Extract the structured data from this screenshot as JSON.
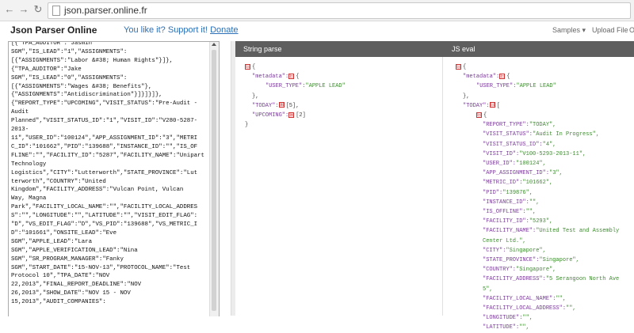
{
  "browser": {
    "url": "json.parser.online.fr"
  },
  "header": {
    "brand": "Json Parser Online",
    "tagline_text": "You like it? Support it!",
    "donate_label": "Donate",
    "menu_samples": "Samples ▾",
    "menu_upload": "Upload File",
    "menu_more": "O"
  },
  "left": {
    "lines": [
      "[{\"TPA_AUDITOR\":\"Jasmin",
      "SGM\",\"IS_LEAD\":\"1\",\"ASSIGNMENTS\":",
      "[{\"ASSIGNMENTS\":\"Labor &#38; Human Rights\"}]},",
      "{\"TPA_AUDITOR\":\"Jake",
      "SGM\",\"IS_LEAD\":\"0\",\"ASSIGNMENTS\":",
      "[{\"ASSIGNMENTS\":\"Wages &#38; Benefits\"},",
      "{\"ASSIGNMENTS\":\"Antidiscrimination\"}]}]}]},",
      "{\"REPORT_TYPE\":\"UPCOMING\",\"VISIT_STATUS\":\"Pre-Audit -",
      "Audit",
      "Planned\",\"VISIT_STATUS_ID\":\"1\",\"VISIT_ID\":\"V280-5287-",
      "2013-",
      "11\",\"USER_ID\":\"100124\",\"APP_ASSIGNMENT_ID\":\"3\",\"METRI",
      "C_ID\":\"101662\",\"PID\":\"139688\",\"INSTANCE_ID\":\"\",\"IS_OF",
      "FLINE\":\"\",\"FACILITY_ID\":\"5287\",\"FACILITY_NAME\":\"Unipart",
      "Technology",
      "Logistics\",\"CITY\":\"Lutterworth\",\"STATE_PROVINCE\":\"Lut",
      "terworth\",\"COUNTRY\":\"United",
      "Kingdom\",\"FACILITY_ADDRESS\":\"Vulcan Point, Vulcan",
      "Way, Magna",
      "Park\",\"FACILITY_LOCAL_NAME\":\"\",\"FACILITY_LOCAL_ADDRES",
      "S\":\"\",\"LONGITUDE\":\"\",\"LATITUDE\":\"\",\"VISIT_EDIT_FLAG\":",
      "\"D\",\"VS_EDIT_FLAG\":\"D\",\"VS_PID\":\"139688\",\"VS_METRIC_I",
      "D\":\"101661\",\"ONSITE_LEAD\":\"Eve",
      "SGM\",\"APPLE_LEAD\":\"Lara",
      "SGM\",\"APPLE_VERIFICATION_LEAD\":\"Nina",
      "SGM\",\"SR_PROGRAM_MANAGER\":\"Fanky",
      "SGM\",\"START_DATE\":\"15-NOV-13\",\"PROTOCOL_NAME\":\"Test",
      "Protocol 10\",\"TPA_DATE\":\"NOV",
      "22,2013\",\"FINAL_REPORT_DEADLINE\":\"NOV",
      "26,2013\",\"SHOW_DATE\":\"NOV 15 - NOV",
      "15,2013\",\"AUDIT_COMPANIES\":"
    ]
  },
  "string_parse": {
    "title": "String parse",
    "toggle_minus": "⊟",
    "toggle_plus": "⊞",
    "open_brace": "{",
    "close_brace": "}",
    "metadata_key": "\"metadata\":",
    "user_type_key": "\"USER_TYPE\":",
    "user_type_value": "\"APPLE LEAD\"",
    "metadata_close": "},",
    "today_key": "\"TODAY\":",
    "today_count": "[5],",
    "upcoming_key": "\"UPCOMING\":",
    "upcoming_count": "[2]"
  },
  "js_eval": {
    "title": "JS eval",
    "open_brace": "{",
    "metadata_key": "\"metadata\":",
    "user_type_key": "\"USER_TYPE\":",
    "user_type_value": "\"APPLE LEAD\"",
    "metadata_close": "},",
    "today_key": "\"TODAY\":",
    "inner_open": "[",
    "item_open": "{",
    "fields": [
      {
        "key": "\"REPORT_TYPE\":",
        "value": "\"TODAY\","
      },
      {
        "key": "\"VISIT_STATUS\":",
        "value": "\"Audit In Progress\","
      },
      {
        "key": "\"VISIT_STATUS_ID\":",
        "value": "\"4\","
      },
      {
        "key": "\"VISIT_ID\":",
        "value": "\"V100-5293-2013-11\","
      },
      {
        "key": "\"USER_ID\":",
        "value": "\"100124\","
      },
      {
        "key": "\"APP_ASSIGNMENT_ID\":",
        "value": "\"3\","
      },
      {
        "key": "\"METRIC_ID\":",
        "value": "\"101662\","
      },
      {
        "key": "\"PID\":",
        "value": "\"139876\","
      },
      {
        "key": "\"INSTANCE_ID\":",
        "value": "\"\","
      },
      {
        "key": "\"IS_OFFLINE\":",
        "value": "\"\","
      },
      {
        "key": "\"FACILITY_ID\":",
        "value": "\"5293\","
      },
      {
        "key": "\"FACILITY_NAME\":",
        "value": "\"United Test and Assembly"
      },
      {
        "key": "",
        "value": "Center Ltd.\","
      },
      {
        "key": "\"CITY\":",
        "value": "\"Singapore\","
      },
      {
        "key": "\"STATE_PROVINCE\":",
        "value": "\"Singapore\","
      },
      {
        "key": "\"COUNTRY\":",
        "value": "\"Singapore\","
      },
      {
        "key": "\"FACILITY_ADDRESS\":",
        "value": "\"5 Serangoon North Ave"
      },
      {
        "key": "",
        "value": "5\","
      },
      {
        "key": "\"FACILITY_LOCAL_NAME\":",
        "value": "\"\","
      },
      {
        "key": "\"FACILITY_LOCAL_ADDRESS\":",
        "value": "\"\","
      },
      {
        "key": "\"LONGITUDE\":",
        "value": "\"\","
      },
      {
        "key": "\"LATITUDE\":",
        "value": "\"\","
      }
    ]
  }
}
